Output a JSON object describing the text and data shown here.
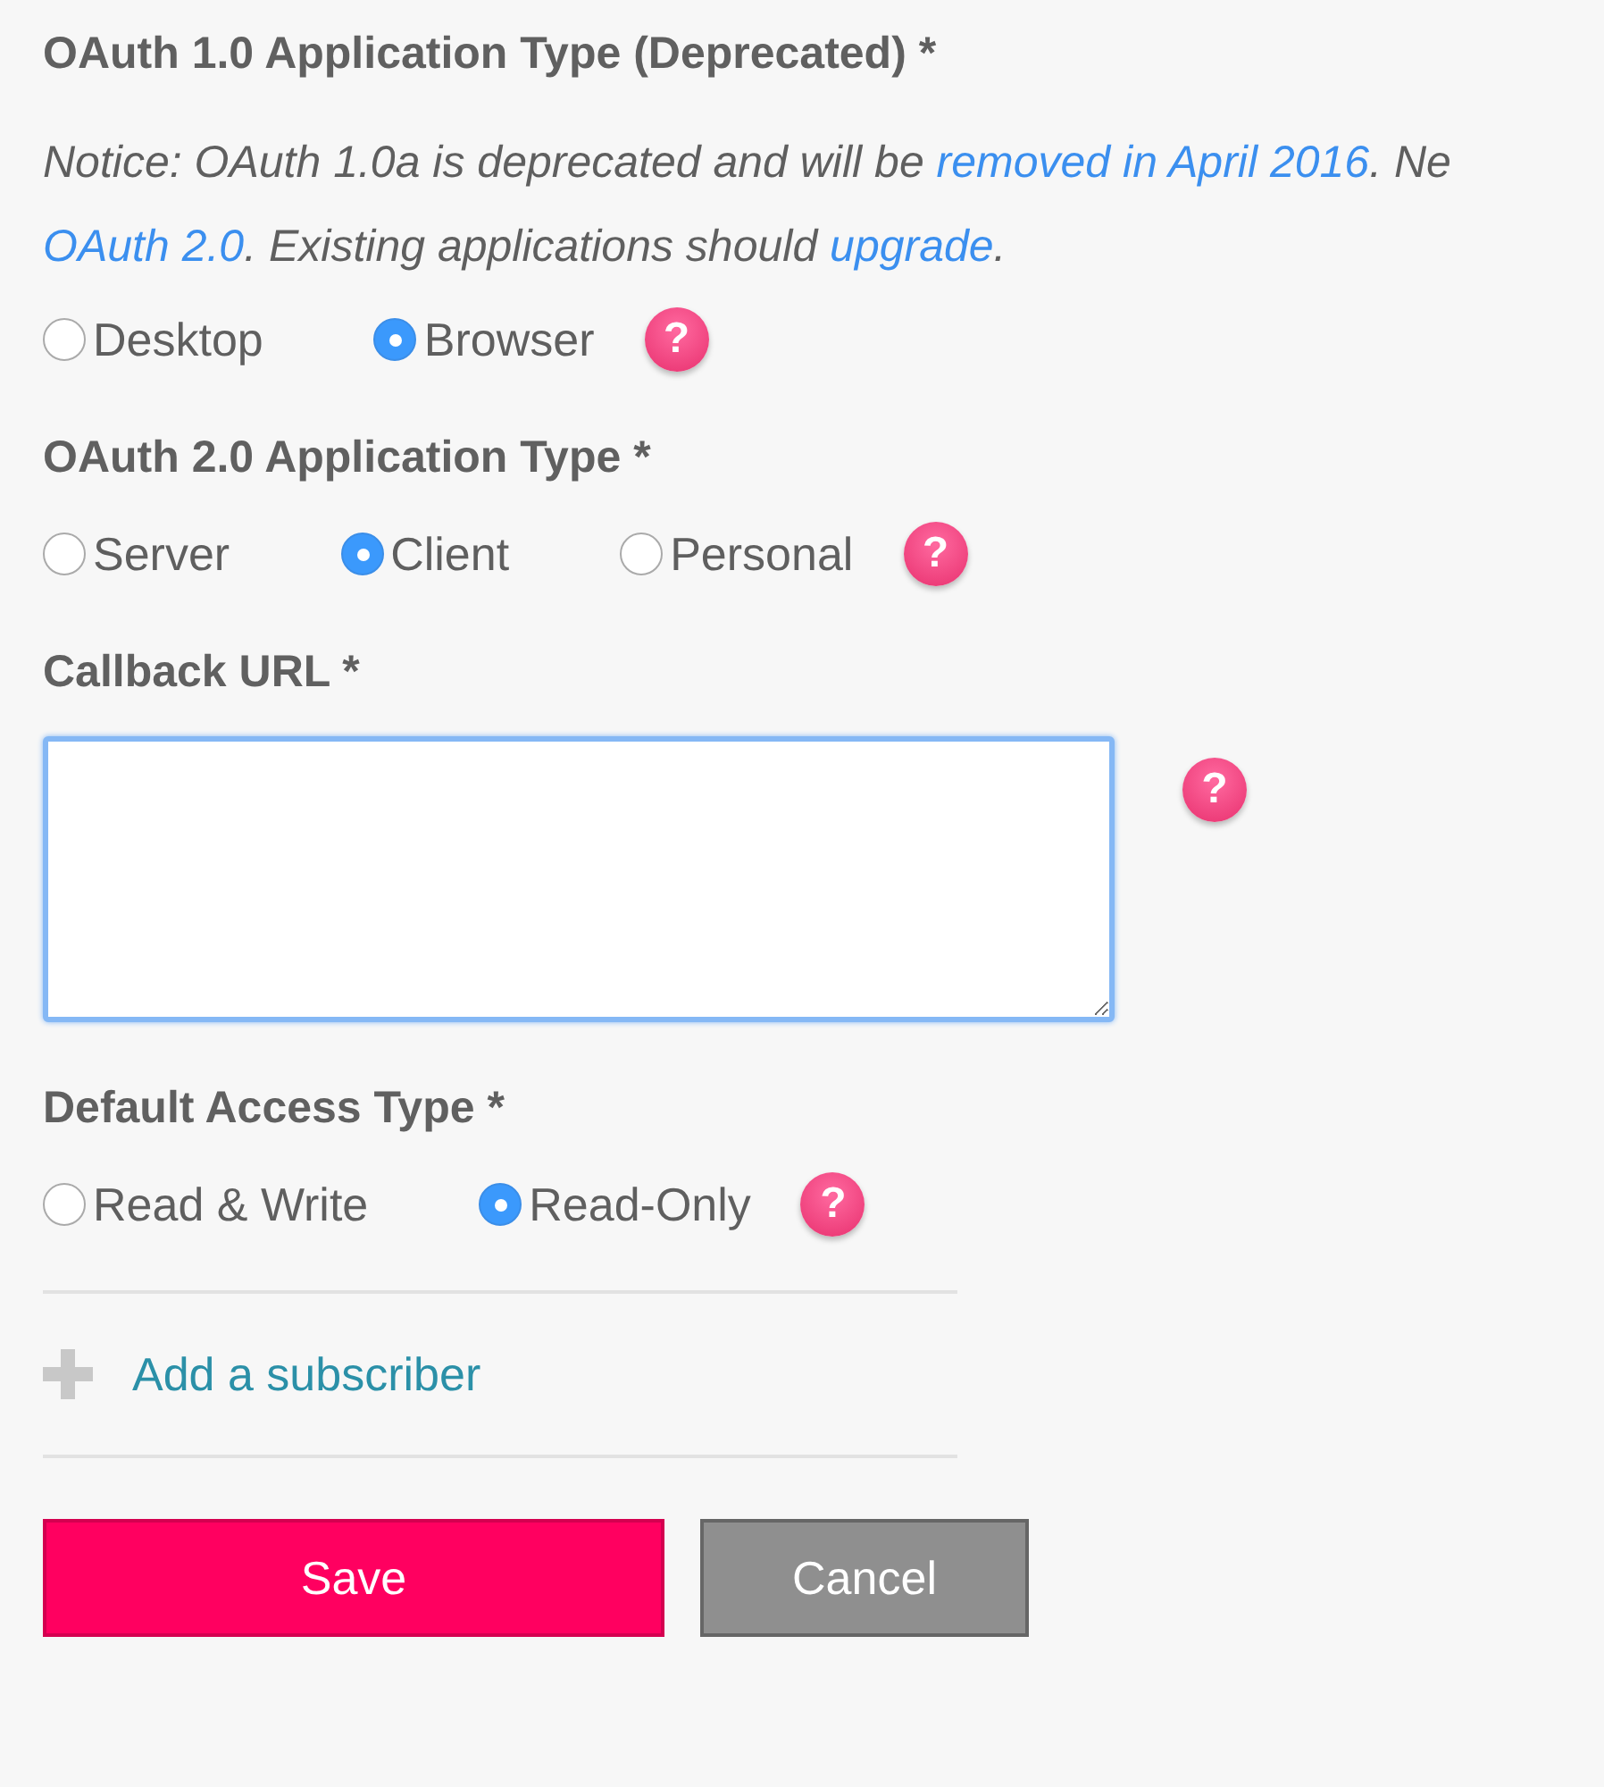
{
  "sections": [
    {
      "kind": "radio",
      "label": "OAuth 1.0 Application Type (Deprecated) *",
      "notice": [
        [
          {
            "text": "Notice: OAuth 1.0a is deprecated and will be ",
            "link": false
          },
          {
            "text": "removed in April 2016",
            "link": true
          },
          {
            "text": ". Ne",
            "link": false
          }
        ],
        [
          {
            "text": "OAuth 2.0",
            "link": true
          },
          {
            "text": ". Existing applications should ",
            "link": false
          },
          {
            "text": "upgrade",
            "link": true
          },
          {
            "text": ".",
            "link": false
          }
        ]
      ],
      "options": [
        {
          "label": "Desktop",
          "selected": false
        },
        {
          "label": "Browser",
          "selected": true
        }
      ],
      "help": "?"
    },
    {
      "kind": "radio",
      "label": "OAuth 2.0 Application Type *",
      "options": [
        {
          "label": "Server",
          "selected": false
        },
        {
          "label": "Client",
          "selected": true
        },
        {
          "label": "Personal",
          "selected": false
        }
      ],
      "help": "?"
    },
    {
      "kind": "textarea",
      "label": "Callback URL *",
      "help": "?"
    },
    {
      "kind": "radio",
      "label": "Default Access Type *",
      "options": [
        {
          "label": "Read & Write",
          "selected": false
        },
        {
          "label": "Read-Only",
          "selected": true
        }
      ],
      "help": "?"
    }
  ],
  "add_link": "Add a subscriber",
  "buttons": {
    "save": "Save",
    "cancel": "Cancel"
  }
}
